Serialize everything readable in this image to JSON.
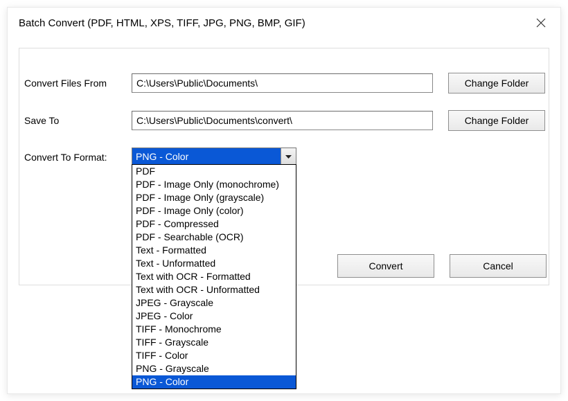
{
  "title": "Batch Convert (PDF, HTML, XPS, TIFF, JPG, PNG, BMP, GIF)",
  "labels": {
    "from": "Convert Files From",
    "saveTo": "Save To",
    "format": "Convert To Format:"
  },
  "paths": {
    "from": "C:\\Users\\Public\\Documents\\",
    "saveTo": "C:\\Users\\Public\\Documents\\convert\\"
  },
  "buttons": {
    "changeFolder": "Change Folder",
    "convert": "Convert",
    "cancel": "Cancel"
  },
  "combo": {
    "selected": "PNG - Color",
    "options": [
      "PDF",
      "PDF - Image Only (monochrome)",
      "PDF - Image Only (grayscale)",
      "PDF - Image Only (color)",
      "PDF - Compressed",
      "PDF - Searchable (OCR)",
      "Text - Formatted",
      "Text - Unformatted",
      "Text with OCR - Formatted",
      "Text with OCR - Unformatted",
      "JPEG - Grayscale",
      "JPEG - Color",
      "TIFF - Monochrome",
      "TIFF - Grayscale",
      "TIFF - Color",
      "PNG - Grayscale",
      "PNG - Color"
    ]
  }
}
